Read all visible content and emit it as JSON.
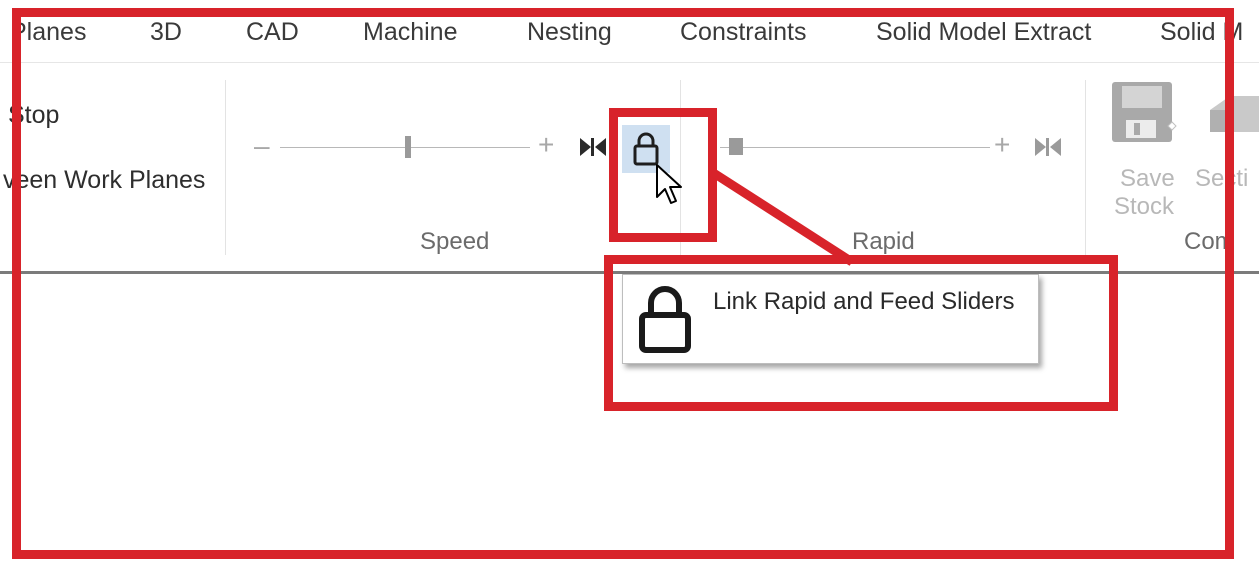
{
  "tabs": [
    {
      "label": "Planes"
    },
    {
      "label": "3D"
    },
    {
      "label": "CAD"
    },
    {
      "label": "Machine"
    },
    {
      "label": "Nesting"
    },
    {
      "label": "Constraints"
    },
    {
      "label": "Solid Model Extract"
    },
    {
      "label": "Solid M"
    }
  ],
  "ribbon": {
    "left_items": [
      "Stop",
      "veen Work Planes"
    ],
    "speed": {
      "label": "Speed",
      "minus": "–",
      "plus": "+"
    },
    "rapid": {
      "label": "Rapid",
      "plus": "+"
    },
    "save_stock": {
      "line1": "Save",
      "line2": "Stock"
    },
    "section": {
      "label": "Secti"
    },
    "commands_label": "Com"
  },
  "tooltip": {
    "text": "Link Rapid and Feed Sliders"
  },
  "icons": {
    "lock": "lock-icon",
    "skip": "skip-to-end-icon",
    "save": "save-disk-icon",
    "cursor": "mouse-pointer-icon"
  },
  "colors": {
    "annotation": "#d8232a",
    "hover": "#cfe0f1",
    "ribbon_border": "#7b7b7b"
  }
}
